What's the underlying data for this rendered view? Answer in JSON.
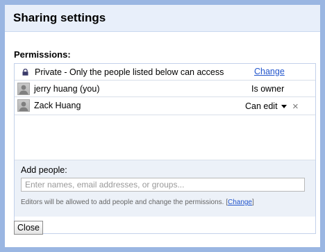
{
  "dialog": {
    "title": "Sharing settings"
  },
  "permissions": {
    "label": "Permissions:",
    "visibility": {
      "text": "Private - Only the people listed below can access",
      "change_label": "Change",
      "icon": "lock-icon"
    },
    "people": [
      {
        "name": "jerry huang (you)",
        "role": "Is owner",
        "avatar": "avatar"
      },
      {
        "name": "Zack Huang",
        "role": "Can edit",
        "avatar": "avatar",
        "remove_icon": "×"
      }
    ]
  },
  "add_people": {
    "label": "Add people:",
    "placeholder": "Enter names, email addresses, or groups...",
    "value": "",
    "hint": "Editors will be allowed to add people and change the permissions.",
    "hint_link_open": "[",
    "hint_link": "Change",
    "hint_link_close": "]"
  },
  "actions": {
    "close_label": "Close"
  },
  "colors": {
    "frame": "#9ab6e2",
    "titlebar": "#e8effa",
    "link": "#2255cc",
    "add_area": "#ecf1f8"
  }
}
